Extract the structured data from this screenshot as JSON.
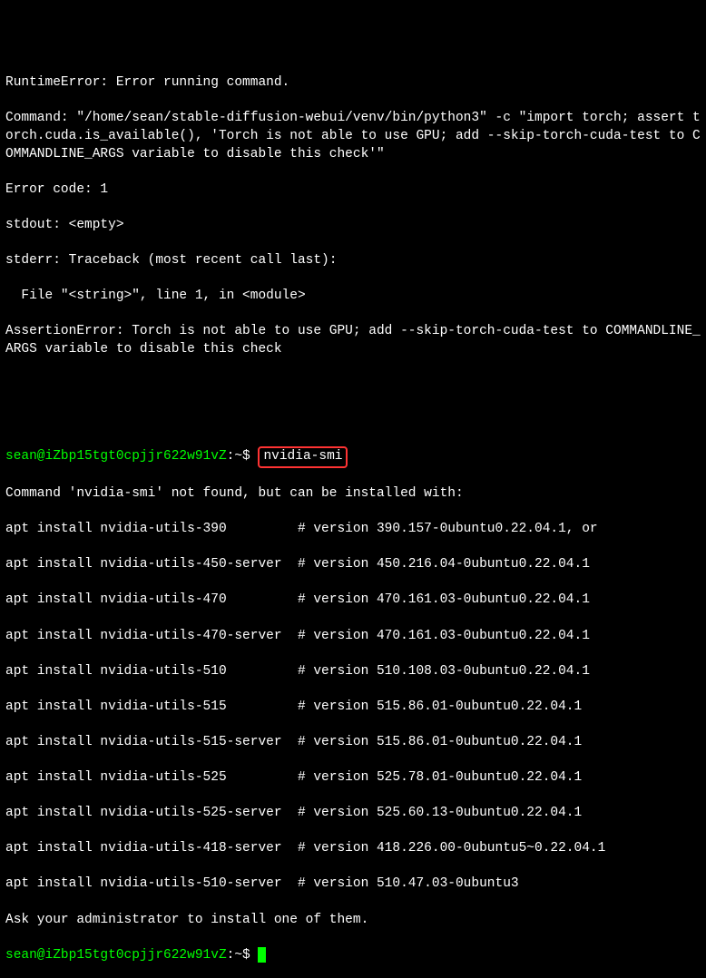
{
  "error_block": {
    "line1": "RuntimeError: Error running command.",
    "line2": "Command: \"/home/sean/stable-diffusion-webui/venv/bin/python3\" -c \"import torch; assert torch.cuda.is_available(), 'Torch is not able to use GPU; add --skip-torch-cuda-test to COMMANDLINE_ARGS variable to disable this check'\"",
    "line3": "Error code: 1",
    "line4": "stdout: <empty>",
    "line5": "stderr: Traceback (most recent call last):",
    "line6": "  File \"<string>\", line 1, in <module>",
    "line7": "AssertionError: Torch is not able to use GPU; add --skip-torch-cuda-test to COMMANDLINE_ARGS variable to disable this check"
  },
  "prompt1": {
    "user_host": "sean@iZbp15tgt0cpjjr622w91vZ",
    "path": ":~$ ",
    "command": "nvidia-smi"
  },
  "not_found": "Command 'nvidia-smi' not found, but can be installed with:",
  "apt_lines": [
    "apt install nvidia-utils-390         # version 390.157-0ubuntu0.22.04.1, or",
    "apt install nvidia-utils-450-server  # version 450.216.04-0ubuntu0.22.04.1",
    "apt install nvidia-utils-470         # version 470.161.03-0ubuntu0.22.04.1",
    "apt install nvidia-utils-470-server  # version 470.161.03-0ubuntu0.22.04.1",
    "apt install nvidia-utils-510         # version 510.108.03-0ubuntu0.22.04.1",
    "apt install nvidia-utils-515         # version 515.86.01-0ubuntu0.22.04.1",
    "apt install nvidia-utils-515-server  # version 515.86.01-0ubuntu0.22.04.1",
    "apt install nvidia-utils-525         # version 525.78.01-0ubuntu0.22.04.1",
    "apt install nvidia-utils-525-server  # version 525.60.13-0ubuntu0.22.04.1",
    "apt install nvidia-utils-418-server  # version 418.226.00-0ubuntu5~0.22.04.1",
    "apt install nvidia-utils-510-server  # version 510.47.03-0ubuntu3"
  ],
  "ask_admin": "Ask your administrator to install one of them.",
  "prompt2": {
    "user_host": "sean@iZbp15tgt0cpjjr622w91vZ",
    "path": ":~$ "
  }
}
